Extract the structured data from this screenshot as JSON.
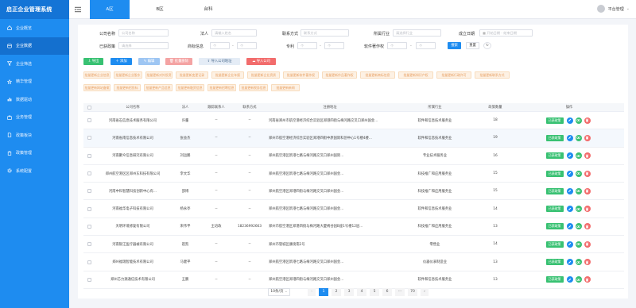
{
  "app": {
    "title": "启正企业管理系统"
  },
  "sidebar": {
    "items": [
      {
        "label": "企业概览",
        "icon": "home-icon",
        "active": false
      },
      {
        "label": "企业数据",
        "icon": "database-icon",
        "active": true
      },
      {
        "label": "企业筛选",
        "icon": "filter-icon",
        "active": false
      },
      {
        "label": "精华管理",
        "icon": "star-icon",
        "active": false
      },
      {
        "label": "数据驱动",
        "icon": "chart-icon",
        "active": false
      },
      {
        "label": "业务管理",
        "icon": "briefcase-icon",
        "active": false
      },
      {
        "label": "政策板块",
        "icon": "document-icon",
        "active": false
      },
      {
        "label": "政策管理",
        "icon": "clipboard-icon",
        "active": false
      },
      {
        "label": "系统配置",
        "icon": "gear-icon",
        "active": false
      }
    ]
  },
  "topbar": {
    "tabs": [
      {
        "label": "A区",
        "active": true
      },
      {
        "label": "B区",
        "active": false
      },
      {
        "label": "台科",
        "active": false
      }
    ],
    "user": "平台管理"
  },
  "filters": {
    "company_name": {
      "label": "公司名称",
      "placeholder": "公司名称"
    },
    "legal_person": {
      "label": "法人",
      "placeholder": "请输入姓名"
    },
    "contact": {
      "label": "联系方式",
      "placeholder": "联系方式"
    },
    "industry": {
      "label": "所属行业",
      "placeholder": "请选择行业"
    },
    "founded": {
      "label": "成立日期",
      "start": "开始日期",
      "end": "结束日期"
    },
    "policy": {
      "label": "已获政策",
      "placeholder": "请选择"
    },
    "trademark": {
      "label": "商标信息"
    },
    "patent": {
      "label": "专利"
    },
    "copyright": {
      "label": "软件著作权"
    },
    "range_from": "个",
    "range_to": "个",
    "search_button": "搜索",
    "reset_button": "重置"
  },
  "toolbar": {
    "export": "导出",
    "add": "添加",
    "edit": "编辑",
    "delete": "批量删除",
    "import_address": "导入公司地址",
    "import_company": "导入公司",
    "colors": {
      "export": "#38c172",
      "add": "#1e8cf0",
      "edit": "#9ec6f3",
      "delete": "#f4a3a3",
      "import_address": "#e4ecf6",
      "import_company": "#f26c6c"
    }
  },
  "chips": [
    "批量更新企业信息",
    "批量更新企业股东",
    "批量更新对外投资",
    "批量更新变更记录",
    "批量更新企业年报",
    "批量更新企业资质",
    "批量更新软件著作权",
    "批量更新作品著作权",
    "批量更新商标信息",
    "批量更新知识产权",
    "批量更新行政许可",
    "批量更新联系方式",
    "批量更新网站备案",
    "批量更新招投标",
    "批量更新产品信息",
    "批量更新融资信息",
    "批量更新招聘信息",
    "批量更新税务信息",
    "批量更新新闻"
  ],
  "table": {
    "headers": [
      "公司名称",
      "法人",
      "所属企业服务人员",
      "联系方式",
      "注册地址",
      "所属行业",
      "政策数量",
      "操作"
    ],
    "headers_short": [
      "公司名称",
      "法人",
      "跟踪联系人",
      "联系方式",
      "注册地址",
      "所属行业",
      "政策数量",
      "操作"
    ],
    "action_label": "已获政策",
    "rows": [
      {
        "name": "河南省石信息技术服务有限公司",
        "legal": "许董",
        "contact_person": "--",
        "phone": "--",
        "address": "河南省郑州市航空港经济综合实验区郑港四街与梅河路交叉口郑州国金...",
        "industry": "软件和信息技术服务业",
        "count": "18"
      },
      {
        "name": "河南省南信息技术有限公司",
        "legal": "张会杰",
        "contact_person": "--",
        "phone": "--",
        "address": "郑州市航空港经济综合实验区郑港四街中原国际科创中心1号楼4楼...",
        "industry": "软件和信息技术服务业",
        "count": "19"
      },
      {
        "name": "河南聚众信息研究有限公司",
        "legal": "刘运鹏",
        "contact_person": "--",
        "phone": "--",
        "address": "郑州航空港区新港七路与梅河路交叉口郑州国际...",
        "industry": "专业技术服务业",
        "count": "16"
      },
      {
        "name": "郑州航空港区区郑州东科技有限公司",
        "legal": "李文华",
        "contact_person": "--",
        "phone": "--",
        "address": "郑州航空港区新港七路与梅河路交叉口郑州国金...",
        "industry": "科技推广和应用服务业",
        "count": "15"
      },
      {
        "name": "河南中科智慧科技创新中心有...",
        "legal": "邵博",
        "contact_person": "--",
        "phone": "--",
        "address": "郑州航空港区郑港四街与梅河路交叉口郑州国金...",
        "industry": "科技推广和应用服务业",
        "count": "15"
      },
      {
        "name": "河南福华电子科技有限公司",
        "legal": "杨永亭",
        "contact_person": "--",
        "phone": "--",
        "address": "郑州航空港区新港七路与梅河路交叉口郑州国金...",
        "industry": "软件和信息技术服务业",
        "count": "14"
      },
      {
        "name": "天明环境修复有限公司",
        "legal": "宋伟平",
        "contact_person": "王培政",
        "phone": "18236992663",
        "address": "郑州市航空港区郑港四街与梅河路大厦绣谷园B座1号楼12层...",
        "industry": "科技推广和应用服务业",
        "count": "13"
      },
      {
        "name": "河南银江医疗器械有限公司",
        "legal": "崔凯",
        "contact_person": "--",
        "phone": "--",
        "address": "郑州市管城区康街南2号",
        "industry": "零售业",
        "count": "14"
      },
      {
        "name": "郑州福瑞智能技术有限公司",
        "legal": "马健平",
        "contact_person": "--",
        "phone": "--",
        "address": "郑州航空港区新港七路与梅河路交叉口郑州国金...",
        "industry": "仪器仪表制造业",
        "count": "13"
      },
      {
        "name": "郑州芯力源通信技术有限公司",
        "legal": "王鹏",
        "contact_person": "--",
        "phone": "--",
        "address": "郑州航空港区郑港四街与梅河路交叉口郑州国金...",
        "industry": "软件和信息技术服务业",
        "count": "13"
      }
    ]
  },
  "pagination": {
    "page_size": "10条/页",
    "pages": [
      "1",
      "2",
      "3",
      "4",
      "5",
      "6",
      "···",
      "70"
    ],
    "current": "1"
  }
}
